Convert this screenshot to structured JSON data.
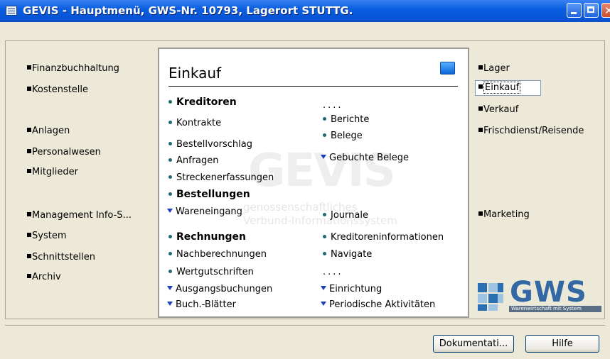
{
  "window": {
    "title": "GEVIS - Hauptmenü, GWS-Nr. 10793, Lagerort STUTTG.",
    "icon": "window-app-icon",
    "controls": [
      "minimize-icon",
      "maximize-icon",
      "close-icon"
    ]
  },
  "left_menu": [
    {
      "label": "Finanzbuchhaltung"
    },
    {
      "label": "Kostenstelle"
    },
    {
      "label": "Anlagen"
    },
    {
      "label": "Personalwesen"
    },
    {
      "label": "Mitglieder"
    },
    {
      "label": "Management Info-S..."
    },
    {
      "label": "System"
    },
    {
      "label": "Schnittstellen"
    },
    {
      "label": "Archiv"
    }
  ],
  "right_menu": [
    {
      "label": "Lager"
    },
    {
      "label": "Einkauf",
      "selected": true
    },
    {
      "label": "Verkauf"
    },
    {
      "label": "Frischdienst/Reisende"
    },
    {
      "label": "Marketing"
    }
  ],
  "panel": {
    "title": "Einkauf",
    "title_icon": "module-icon",
    "watermark": {
      "logo": "GEVIS",
      "line1": "genossenschaftliches",
      "line2": "Verbund-Informationssystem"
    },
    "left_column": [
      {
        "label": "Kreditoren",
        "style": "bold-bullet"
      },
      {
        "label": "Kontrakte",
        "style": "bullet"
      },
      {
        "label": "Bestellvorschlag",
        "style": "bullet"
      },
      {
        "label": "Anfragen",
        "style": "bullet"
      },
      {
        "label": "Streckenerfassungen",
        "style": "bullet"
      },
      {
        "label": "Bestellungen",
        "style": "bold-bullet"
      },
      {
        "label": "Wareneingang",
        "style": "triangle"
      },
      {
        "label": "Rechnungen",
        "style": "bold-bullet"
      },
      {
        "label": "Nachberechnungen",
        "style": "bullet"
      },
      {
        "label": "Wertgutschriften",
        "style": "bullet"
      },
      {
        "label": "Ausgangsbuchungen",
        "style": "triangle"
      },
      {
        "label": "Buch.-Blätter",
        "style": "triangle"
      }
    ],
    "right_column": [
      {
        "label": "....",
        "style": "dots"
      },
      {
        "label": "Berichte",
        "style": "bullet"
      },
      {
        "label": "Belege",
        "style": "bullet"
      },
      {
        "label": "Gebuchte Belege",
        "style": "triangle"
      },
      {
        "label": "Journale",
        "style": "bullet"
      },
      {
        "label": "Kreditoreninformationen",
        "style": "bullet"
      },
      {
        "label": "Navigate",
        "style": "bullet"
      },
      {
        "label": "....",
        "style": "dots"
      },
      {
        "label": "Einrichtung",
        "style": "triangle"
      },
      {
        "label": "Periodische Aktivitäten",
        "style": "triangle"
      }
    ]
  },
  "logo": {
    "text": "GWS",
    "tagline": "Warenwirtschaft mit System",
    "colors": {
      "dark": "#2a6fb2",
      "light": "#9fc3e3",
      "text": "#3468a4"
    }
  },
  "buttons": {
    "docs": "Dokumentati...",
    "help": "Hilfe"
  },
  "colors": {
    "titlebar": "#0a5fe0",
    "window_bg": "#ece9d8",
    "bullet": "#1c6b74",
    "triangle": "#1c3fbf"
  }
}
